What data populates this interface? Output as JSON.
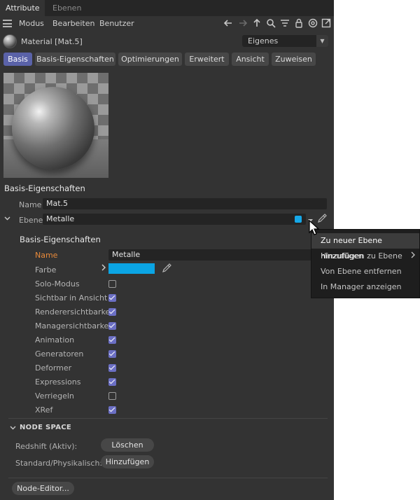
{
  "tabs": {
    "active": "Attribute",
    "inactive": "Ebenen"
  },
  "menu": {
    "items": [
      "Modus",
      "Bearbeiten",
      "Benutzer"
    ]
  },
  "toolbar": {
    "icons": [
      "arrow-left-icon",
      "arrow-right-icon",
      "arrow-up-icon",
      "search-icon",
      "filter-icon",
      "lock-icon",
      "target-icon",
      "new-window-icon"
    ]
  },
  "material": {
    "label": "Material [Mat.5]",
    "mode_select": "Eigenes"
  },
  "subtabs": [
    "Basis",
    "Basis-Eigenschaften",
    "Optimierungen",
    "Erweitert",
    "Ansicht",
    "Zuweisen"
  ],
  "basis": {
    "title": "Basis-Eigenschaften",
    "name_label": "Name",
    "name_value": "Mat.5",
    "ebene_label": "Ebene",
    "ebene_value": "Metalle",
    "ebene_color": "#16a8e8"
  },
  "layer": {
    "title": "Basis-Eigenschaften",
    "name_label": "Name",
    "name_value": "Metalle",
    "farbe_label": "Farbe",
    "farbe_color": "#0ba5e4",
    "props": [
      {
        "label": "Solo-Modus",
        "checked": false
      },
      {
        "label": "Sichtbar in Ansicht",
        "checked": true
      },
      {
        "label": "Renderersichtbarkeit",
        "checked": true
      },
      {
        "label": "Managersichtbarkeit",
        "checked": true
      },
      {
        "label": "Animation",
        "checked": true
      },
      {
        "label": "Generatoren",
        "checked": true
      },
      {
        "label": "Deformer",
        "checked": true
      },
      {
        "label": "Expressions",
        "checked": true
      },
      {
        "label": "Verriegeln",
        "checked": false
      },
      {
        "label": "XRef",
        "checked": true
      }
    ]
  },
  "node_space": {
    "title": "NODE SPACE",
    "redshift_label": "Redshift (Aktiv):",
    "redshift_button": "Löschen",
    "standard_label": "Standard/Physikalisch:",
    "standard_button": "Hinzufügen",
    "editor_button": "Node-Editor..."
  },
  "context_menu": {
    "items": [
      "Zu neuer Ebene hinzufügen",
      "Hinzufügen zu Ebene",
      "Von Ebene entfernen",
      "In Manager anzeigen"
    ]
  },
  "colors": {
    "panel_bg": "#333333",
    "accent": "#5a62a8",
    "highlight_label": "#e88a3a"
  }
}
